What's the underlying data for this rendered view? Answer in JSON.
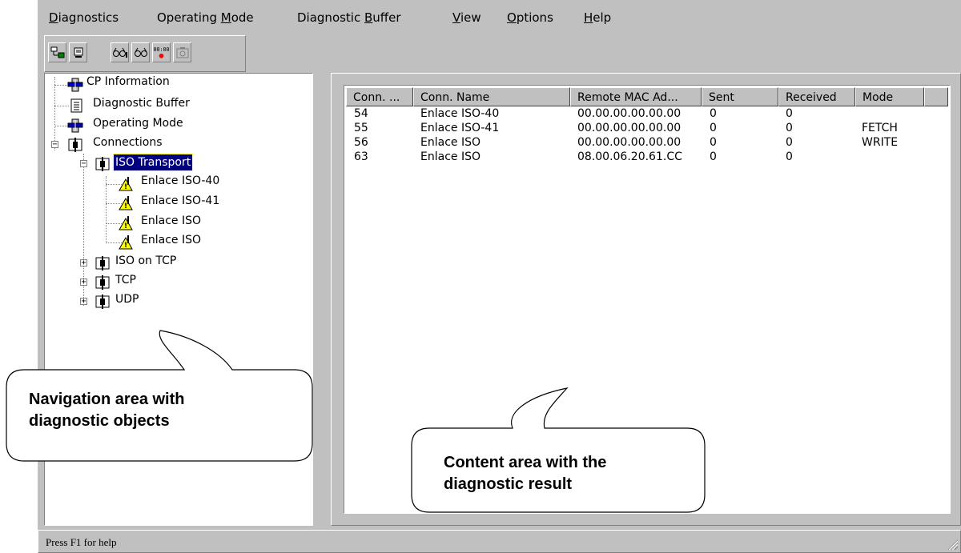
{
  "menu": [
    {
      "pre": "",
      "u": "D",
      "post": "iagnostics"
    },
    {
      "pre": "Operating ",
      "u": "M",
      "post": "ode"
    },
    {
      "pre": "Diagnostic ",
      "u": "B",
      "post": "uffer"
    },
    {
      "pre": "",
      "u": "V",
      "post": "iew"
    },
    {
      "pre": "",
      "u": "O",
      "post": "ptions"
    },
    {
      "pre": "",
      "u": "H",
      "post": "elp"
    }
  ],
  "toolbar": {
    "counter_label": "00:00"
  },
  "tree": {
    "cp_information": "CP Information",
    "diagnostic_buffer": "Diagnostic Buffer",
    "operating_mode": "Operating Mode",
    "connections": "Connections",
    "iso_transport": "ISO Transport",
    "iso_children": [
      "Enlace ISO-40",
      "Enlace ISO-41",
      "Enlace ISO",
      "Enlace ISO"
    ],
    "iso_on_tcp": "ISO on TCP",
    "tcp": "TCP",
    "udp": "UDP"
  },
  "table": {
    "headers": [
      "Conn. ...",
      "Conn. Name",
      "Remote MAC Ad...",
      "Sent",
      "Received",
      "Mode"
    ],
    "rows": [
      [
        "54",
        "Enlace ISO-40",
        "00.00.00.00.00.00",
        "0",
        "0",
        ""
      ],
      [
        "55",
        "Enlace ISO-41",
        "00.00.00.00.00.00",
        "0",
        "0",
        "FETCH"
      ],
      [
        "56",
        "Enlace ISO",
        "00.00.00.00.00.00",
        "0",
        "0",
        "WRITE"
      ],
      [
        "63",
        "Enlace ISO",
        "08.00.06.20.61.CC",
        "0",
        "0",
        ""
      ]
    ]
  },
  "callouts": {
    "navigation_line1": "Navigation area with",
    "navigation_line2": "diagnostic objects",
    "content_line1": "Content area with the",
    "content_line2": "diagnostic result"
  },
  "status": {
    "help_text": "Press F1 for help"
  },
  "colors": {
    "window_face": "#c0c0c0",
    "selection": "#000080",
    "warning_icon": "#ffff00",
    "record_dot": "#ff0000"
  }
}
